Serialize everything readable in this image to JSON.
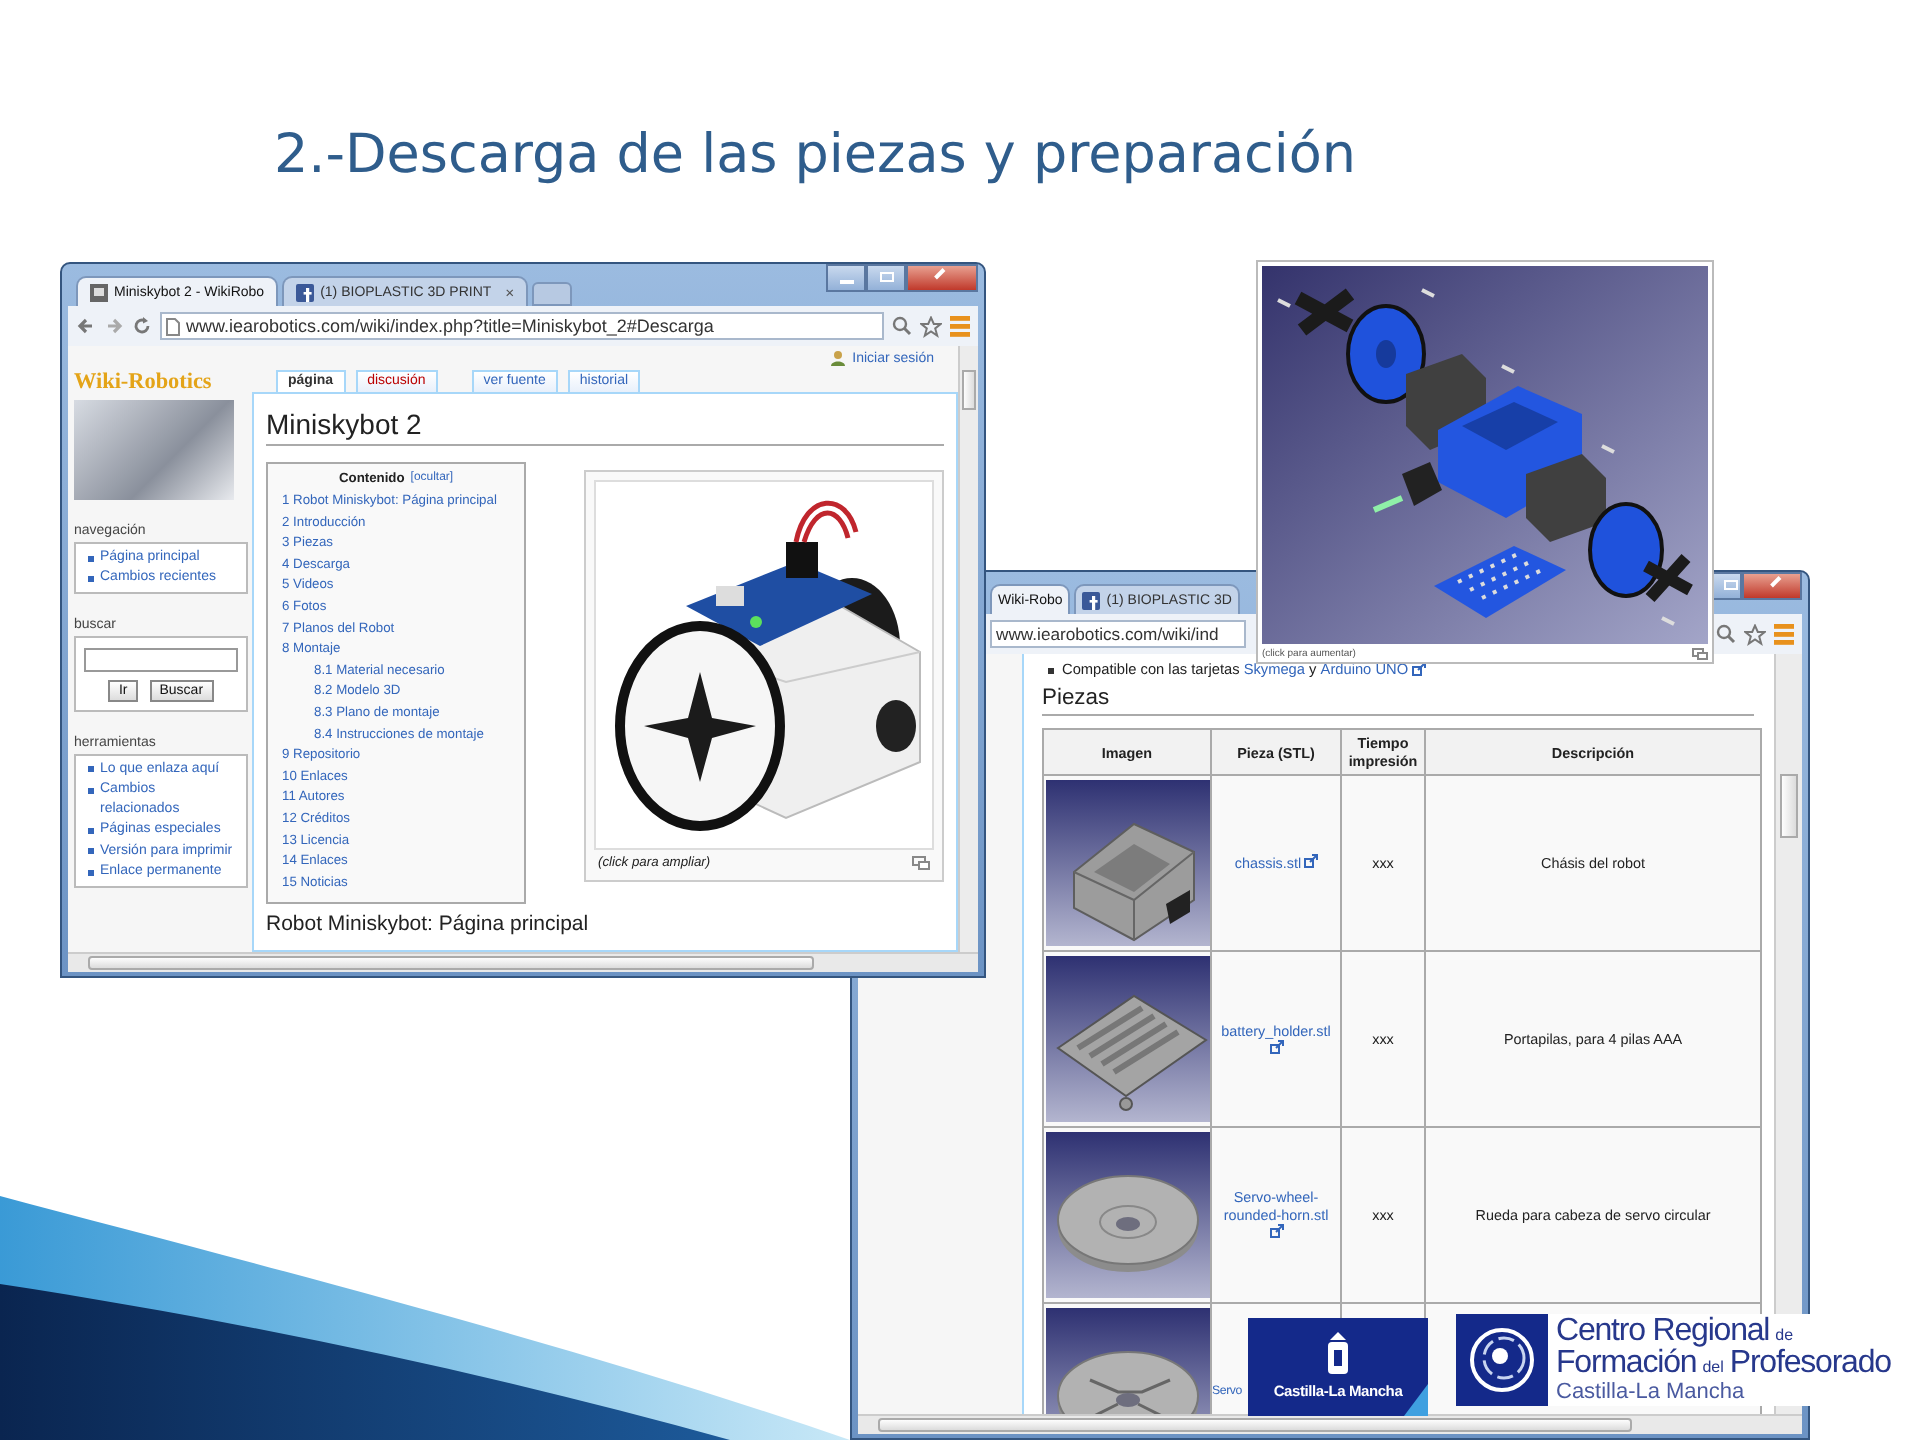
{
  "slide": {
    "title": "2.-Descarga de las piezas y preparación"
  },
  "window_1": {
    "tabs": [
      {
        "label": "Miniskybot 2 - WikiRobo",
        "selected": true,
        "kind": "site"
      },
      {
        "label": "(1) BIOPLASTIC 3D PRINT",
        "selected": false,
        "kind": "social",
        "close": "×"
      }
    ],
    "url": "www.iearobotics.com/wiki/index.php?title=Miniskybot_2#Descarga",
    "login": "Iniciar sesión",
    "logo": "Wiki-Robotics",
    "sidebar": [
      {
        "kind": "links",
        "heading": "navegación",
        "items": [
          "Página principal",
          "Cambios recientes"
        ]
      },
      {
        "kind": "search",
        "heading": "buscar",
        "buttons": [
          "Ir",
          "Buscar"
        ]
      },
      {
        "kind": "links",
        "heading": "herramientas",
        "items": [
          "Lo que enlaza aquí",
          "Cambios relacionados",
          "Páginas especiales",
          "Versión para imprimir",
          "Enlace permanente"
        ]
      }
    ],
    "page_tabs": [
      {
        "label": "página",
        "selected": true,
        "missing": false
      },
      {
        "label": "discusión",
        "selected": false,
        "missing": true
      },
      {
        "label": "ver fuente",
        "selected": false,
        "missing": false
      },
      {
        "label": "historial",
        "selected": false,
        "missing": false
      }
    ],
    "heading": "Miniskybot 2",
    "toc": {
      "title": "Contenido",
      "toggle": "[ocultar]",
      "items": [
        {
          "text": "1 Robot Miniskybot: Página principal"
        },
        {
          "text": "2 Introducción"
        },
        {
          "text": "3 Piezas"
        },
        {
          "text": "4 Descarga"
        },
        {
          "text": "5 Videos"
        },
        {
          "text": "6 Fotos"
        },
        {
          "text": "7 Planos del Robot"
        },
        {
          "text": "8 Montaje",
          "children": [
            {
              "text": "8.1 Material necesario"
            },
            {
              "text": "8.2 Modelo 3D"
            },
            {
              "text": "8.3 Plano de montaje"
            },
            {
              "text": "8.4 Instrucciones de montaje"
            }
          ]
        },
        {
          "text": "9 Repositorio"
        },
        {
          "text": "10 Enlaces"
        },
        {
          "text": "11 Autores"
        },
        {
          "text": "12 Créditos"
        },
        {
          "text": "13 Licencia"
        },
        {
          "text": "14 Enlaces"
        },
        {
          "text": "15 Noticias"
        }
      ]
    },
    "figure": {
      "caption": "(click para ampliar)"
    },
    "section_heading": "Robot Miniskybot: Página principal"
  },
  "window_2": {
    "tabs": [
      {
        "label": "Wiki-Robo",
        "selected": true,
        "kind": "plain"
      },
      {
        "label": "(1) BIOPLASTIC 3D",
        "selected": false,
        "kind": "social"
      }
    ],
    "url": "www.iearobotics.com/wiki/ind",
    "bullet": [
      {
        "kind": "text",
        "text": "Compatible con las tarjetas "
      },
      {
        "kind": "link",
        "text": "Skymega",
        "external": false
      },
      {
        "kind": "text",
        "text": " y "
      },
      {
        "kind": "link",
        "text": "Arduino UNO",
        "external": true
      }
    ],
    "heading": "Piezas",
    "table": {
      "columns": [
        "Imagen",
        "Pieza (STL)",
        "Tiempo impresión",
        "Descripción"
      ],
      "rows": [
        {
          "kind": "chassis",
          "file": "chassis.stl",
          "external": true,
          "time": "xxx",
          "description": "Chásis del robot"
        },
        {
          "kind": "battery_holder",
          "file": "battery_holder.stl",
          "external": true,
          "time": "xxx",
          "description": "Portapilas, para 4 pilas AAA"
        },
        {
          "kind": "wheel",
          "file": "Servo-wheel-rounded-horn.stl",
          "external": true,
          "time": "xxx",
          "description": "Rueda para cabeza de servo circular"
        },
        {
          "kind": "wheel_slotted",
          "file": "Servo",
          "external": false
        }
      ]
    }
  },
  "model_render": {
    "caption": "(click para aumentar)"
  },
  "logos": {
    "castilla_la_mancha": {
      "text": "Castilla-La Mancha"
    },
    "crfp": {
      "lines": [
        [
          {
            "text": "Centro Regional",
            "small": false
          },
          {
            "text": "de",
            "small": true
          }
        ],
        [
          {
            "text": "Formación",
            "small": false
          },
          {
            "text": "del",
            "small": true
          },
          {
            "text": "Profesorado",
            "small": false
          }
        ],
        [
          {
            "text": "Castilla-La Mancha",
            "small": true
          }
        ]
      ]
    }
  }
}
